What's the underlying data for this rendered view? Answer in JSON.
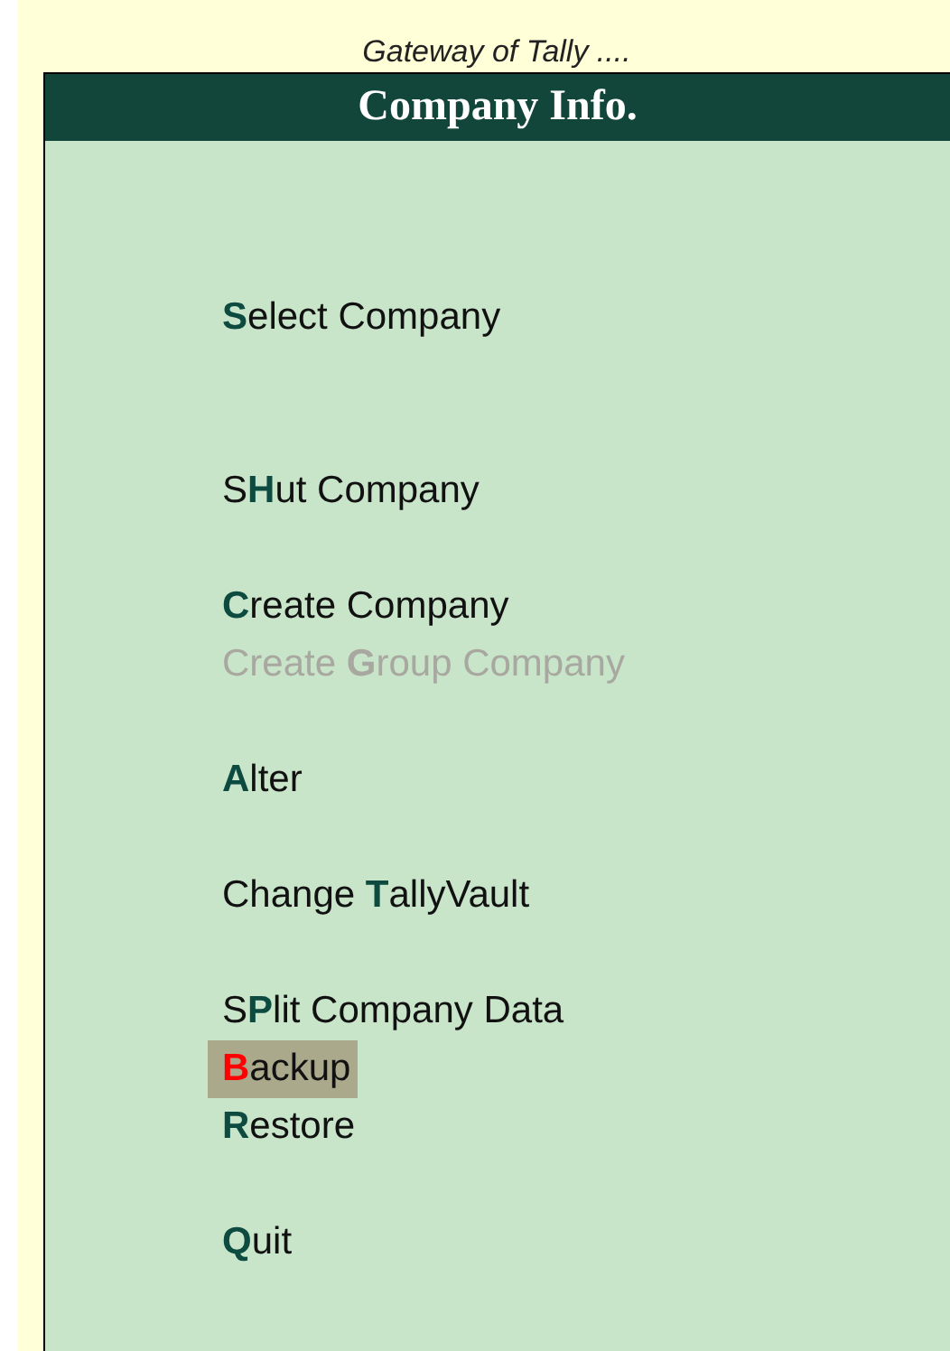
{
  "breadcrumb": "Gateway of Tally ....",
  "panel": {
    "title": "Company Info."
  },
  "menu_groups": [
    [
      {
        "label": "**S**elect Company",
        "disabled": false,
        "selected": false
      }
    ],
    [
      {
        "label": "S**H**ut Company",
        "disabled": false,
        "selected": false
      }
    ],
    [
      {
        "label": "**C**reate Company",
        "disabled": false,
        "selected": false
      },
      {
        "label": "Create **G**roup Company",
        "disabled": true,
        "selected": false
      }
    ],
    [
      {
        "label": "**A**lter",
        "disabled": false,
        "selected": false
      }
    ],
    [
      {
        "label": "Change **T**allyVault",
        "disabled": false,
        "selected": false
      }
    ],
    [
      {
        "label": "S**P**lit Company Data",
        "disabled": false,
        "selected": false
      },
      {
        "label": "**B**ackup",
        "disabled": false,
        "selected": true
      },
      {
        "label": "**R**estore",
        "disabled": false,
        "selected": false
      }
    ],
    [
      {
        "label": "**Q**uit",
        "disabled": false,
        "selected": false
      }
    ]
  ]
}
